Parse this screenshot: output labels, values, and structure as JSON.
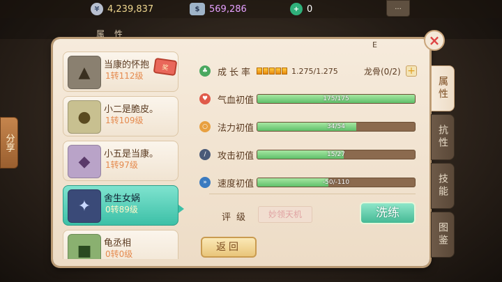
{
  "resources": [
    {
      "icon": "silver-coin-icon",
      "value": "4,239,837",
      "color": "#f0d890"
    },
    {
      "icon": "cash-stack-icon",
      "value": "569,286",
      "color": "#e6a0ff"
    },
    {
      "icon": "jade-gem-icon",
      "value": "0",
      "color": "#ffffff"
    }
  ],
  "menu_label": "...",
  "window_title": "属性",
  "e_label": "E",
  "share_label": "分享",
  "pets": [
    {
      "name": "当康的怀抱",
      "level": "1转112级",
      "avatar_icon": "stone-golem-icon",
      "ticket": "奖"
    },
    {
      "name": "小二是脆皮。",
      "level": "1转109级",
      "avatar_icon": "monk-icon"
    },
    {
      "name": "小五是当康。",
      "level": "1转97级",
      "avatar_icon": "boar-icon"
    },
    {
      "name": "舍生女娲",
      "level": "0转89级",
      "avatar_icon": "nuwa-icon",
      "selected": true
    },
    {
      "name": "龟丞相",
      "level": "0转0级",
      "avatar_icon": "turtle-icon"
    }
  ],
  "growth": {
    "label": "成长率",
    "value": "1.275/1.275",
    "stars": 5,
    "dragon_bone": "龙骨(0/2)",
    "plus": "+"
  },
  "stats": [
    {
      "label": "气血初值",
      "value": "175/175",
      "fill": 1.0,
      "icon": "heart-icon",
      "icon_color": "#e05a4a"
    },
    {
      "label": "法力初值",
      "value": "34/54",
      "fill": 0.63,
      "icon": "mana-icon",
      "icon_color": "#e8a040"
    },
    {
      "label": "攻击初值",
      "value": "15/27",
      "fill": 0.55,
      "icon": "sword-icon",
      "icon_color": "#4a5a78"
    },
    {
      "label": "速度初值",
      "value": "-50/-110",
      "fill": 0.45,
      "icon": "speed-icon",
      "icon_color": "#3a7ac0"
    }
  ],
  "rating": {
    "label": "评级",
    "value": "妙领天机"
  },
  "wash_button": "洗练",
  "back_button": "返回",
  "side_tabs": [
    {
      "label": "属性",
      "active": true
    },
    {
      "label": "抗性"
    },
    {
      "label": "技能"
    },
    {
      "label": "图鉴"
    }
  ]
}
